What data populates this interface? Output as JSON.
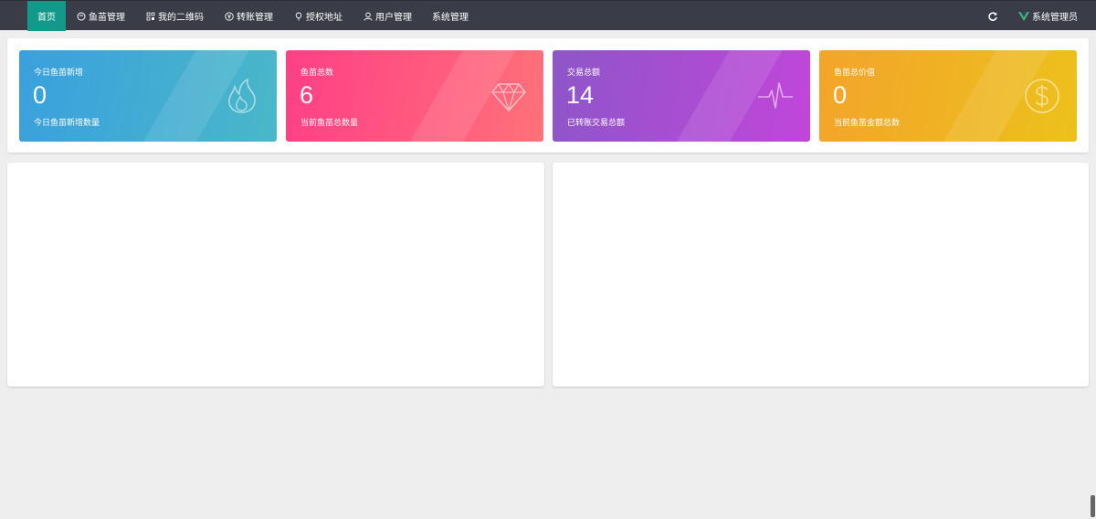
{
  "nav": {
    "items": [
      {
        "label": "首页",
        "icon": "home",
        "active": true
      },
      {
        "label": "鱼苗管理",
        "icon": "fish-fry-icon",
        "active": false
      },
      {
        "label": "我的二维码",
        "icon": "qrcode-icon",
        "active": false
      },
      {
        "label": "转账管理",
        "icon": "yen-icon",
        "active": false
      },
      {
        "label": "授权地址",
        "icon": "pin-icon",
        "active": false
      },
      {
        "label": "用户管理",
        "icon": "user-icon",
        "active": false
      },
      {
        "label": "系统管理",
        "icon": "",
        "active": false
      }
    ]
  },
  "header": {
    "user_label": "系统管理员"
  },
  "stats": [
    {
      "title": "今日鱼苗新增",
      "value": "0",
      "desc": "今日鱼苗新增数量",
      "icon": "fire-icon",
      "color": "#3aa0dd"
    },
    {
      "title": "鱼苗总数",
      "value": "6",
      "desc": "当前鱼苗总数量",
      "icon": "diamond-icon",
      "color": "#ff3f87"
    },
    {
      "title": "交易总额",
      "value": "14",
      "desc": "已转账交易总额",
      "icon": "pulse-icon",
      "color": "#8e56c8"
    },
    {
      "title": "鱼苗总价值",
      "value": "0",
      "desc": "当前鱼苗金额总数",
      "icon": "dollar-icon",
      "color": "#f3a42b"
    }
  ],
  "colors": {
    "topbar": "#3a3d47",
    "active_nav": "#13998a",
    "background": "#eeeeee"
  }
}
